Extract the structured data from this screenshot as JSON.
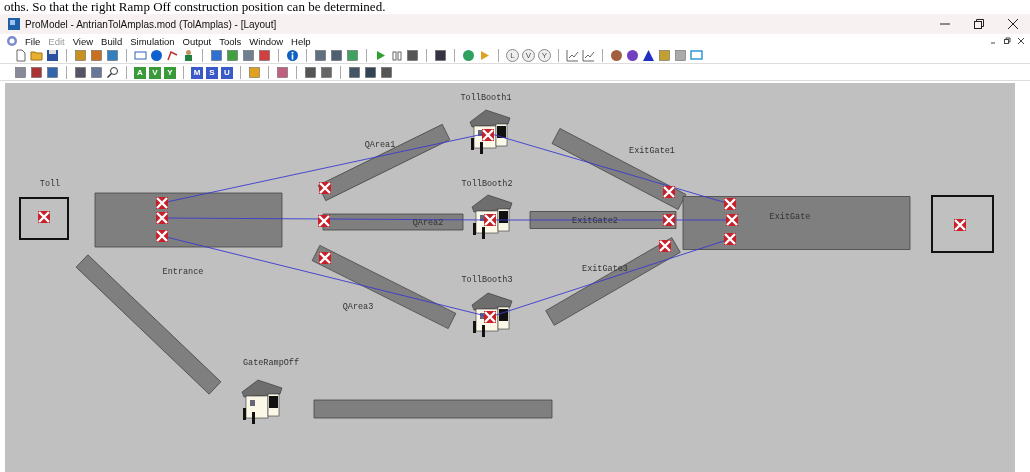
{
  "caption": "oths. So that the right Ramp Off construction position can be determined.",
  "window": {
    "title": "ProModel - AntrianTolAmplas.mod (TolAmplas) - [Layout]"
  },
  "menu": [
    {
      "label": "File",
      "disabled": false
    },
    {
      "label": "Edit",
      "disabled": true
    },
    {
      "label": "View",
      "disabled": false
    },
    {
      "label": "Build",
      "disabled": false
    },
    {
      "label": "Simulation",
      "disabled": false
    },
    {
      "label": "Output",
      "disabled": false
    },
    {
      "label": "Tools",
      "disabled": false
    },
    {
      "label": "Window",
      "disabled": false
    },
    {
      "label": "Help",
      "disabled": false
    }
  ],
  "toolbar_1": {
    "letter_buttons": [
      "L",
      "V",
      "Y"
    ]
  },
  "toolbar_2": {
    "letter_buttons": [
      "A",
      "V",
      "Y",
      "M",
      "S",
      "U"
    ]
  },
  "layout": {
    "locations": [
      {
        "kind": "box",
        "label": "Toll"
      },
      {
        "kind": "bar",
        "label": "Entrance"
      },
      {
        "kind": "bar"
      },
      {
        "kind": "bar",
        "label": "QArea1"
      },
      {
        "kind": "bar",
        "label": "QArea2"
      },
      {
        "kind": "bar",
        "label": "QArea3"
      },
      {
        "kind": "booth",
        "label": "TollBooth1"
      },
      {
        "kind": "booth",
        "label": "TollBooth2"
      },
      {
        "kind": "booth",
        "label": "TollBooth3"
      },
      {
        "kind": "bar",
        "label": "ExitGate1"
      },
      {
        "kind": "bar",
        "label": "ExitGate2"
      },
      {
        "kind": "bar",
        "label": "ExitGate3"
      },
      {
        "kind": "bar",
        "label": "ExitGate"
      },
      {
        "kind": "box"
      },
      {
        "kind": "booth",
        "label": "GateRampOff"
      },
      {
        "kind": "bar"
      }
    ]
  }
}
